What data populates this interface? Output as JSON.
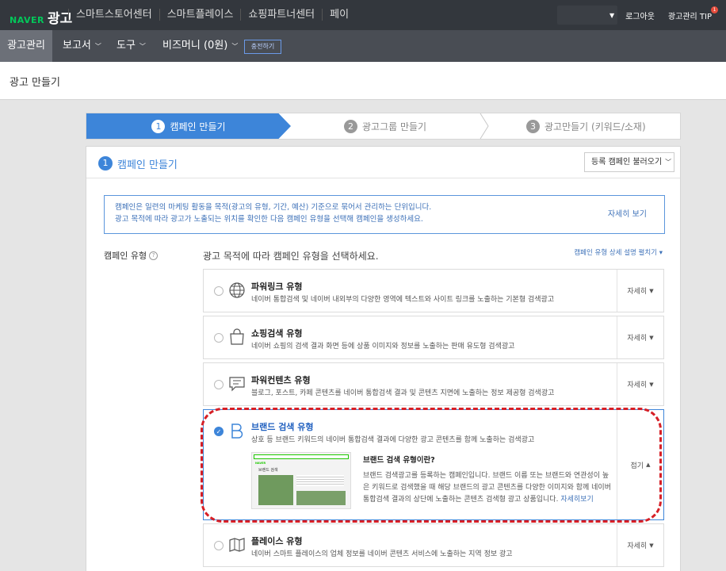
{
  "topbar": {
    "logo_naver": "NAVER",
    "logo_ad": "광고",
    "nav": [
      "스마트스토어센터",
      "스마트플레이스",
      "쇼핑파트너센터",
      "페이"
    ],
    "logout": "로그아웃",
    "tip": "광고관리 TIP",
    "tip_badge": "1"
  },
  "subnav": {
    "items": [
      "광고관리",
      "보고서",
      "도구",
      "비즈머니 (0원)"
    ],
    "charge": "충전하기"
  },
  "page_title": "광고 만들기",
  "steps": [
    {
      "num": "1",
      "label": "캠페인 만들기"
    },
    {
      "num": "2",
      "label": "광고그룹 만들기"
    },
    {
      "num": "3",
      "label": "광고만들기 (키워드/소재)"
    }
  ],
  "panel": {
    "num": "1",
    "title": "캠페인 만들기",
    "load_button": "등록 캠페인 불러오기"
  },
  "info": {
    "line1": "캠페인은 일련의 마케팅 활동을 목적(광고의 유형, 기간, 예산) 기준으로 묶어서 관리하는 단위입니다.",
    "line2": "광고 목적에 따라 광고가 노출되는 위치를 확인한 다음 캠페인 유형을 선택해 캠페인을 생성하세요.",
    "more": "자세히 보기"
  },
  "campaign_type": {
    "label": "캠페인 유형",
    "instruction": "광고 목적에 따라 캠페인 유형을 선택하세요.",
    "detail_toggle": "캠페인 유형 상세 설명 펼치기"
  },
  "cards": [
    {
      "title": "파워링크 유형",
      "desc": "네이버 통합검색 및 네이버 내외부의 다양한 영역에 텍스트와 사이트 링크를 노출하는 기본형 검색광고",
      "side": "자세히",
      "icon": "globe-icon"
    },
    {
      "title": "쇼핑검색 유형",
      "desc": "네이버 쇼핑의 검색 결과 화면 등에 상품 이미지와 정보를 노출하는 판매 유도형 검색광고",
      "side": "자세히",
      "icon": "shopping-bag-icon"
    },
    {
      "title": "파워컨텐츠 유형",
      "desc": "블로그, 포스트, 카페 콘텐츠를 네이버 통합검색 결과 및 콘텐츠 지면에 노출하는 정보 제공형 검색광고",
      "side": "자세히",
      "icon": "chat-content-icon"
    },
    {
      "title": "브랜드 검색 유형",
      "desc": "상호 등 브랜드 키워드의 네이버 통합검색 결과에 다양한 광고 콘텐츠를 함께 노출하는 검색광고",
      "side": "접기",
      "icon": "brand-b-icon"
    },
    {
      "title": "플레이스 유형",
      "desc": "네이버 스마트 플레이스의 업체 정보를 네이버 콘텐츠 서비스에 노출하는 지역 정보 광고",
      "side": "자세히",
      "icon": "map-icon"
    }
  ],
  "brand_detail": {
    "heading": "브랜드 검색 유형이란?",
    "line1": "브랜드 검색광고를 등록하는 캠페인입니다. 브랜드 이름 또는 브랜드와 연관성이 높",
    "line2": "은 키워드로 검색했을 때 해당 브랜드의 광고 콘텐츠를 다양한 이미지와 함께 네이버",
    "line3": "통합검색 결과의 상단에 노출하는 콘텐츠 검색형 광고 상품입니다.",
    "link": "자세히보기",
    "thumb_logo": "NAVER",
    "thumb_title": "브랜드 검색"
  },
  "colors": {
    "accent": "#3d85d9",
    "highlight": "#d61f26",
    "naver_green": "#03c75a"
  }
}
